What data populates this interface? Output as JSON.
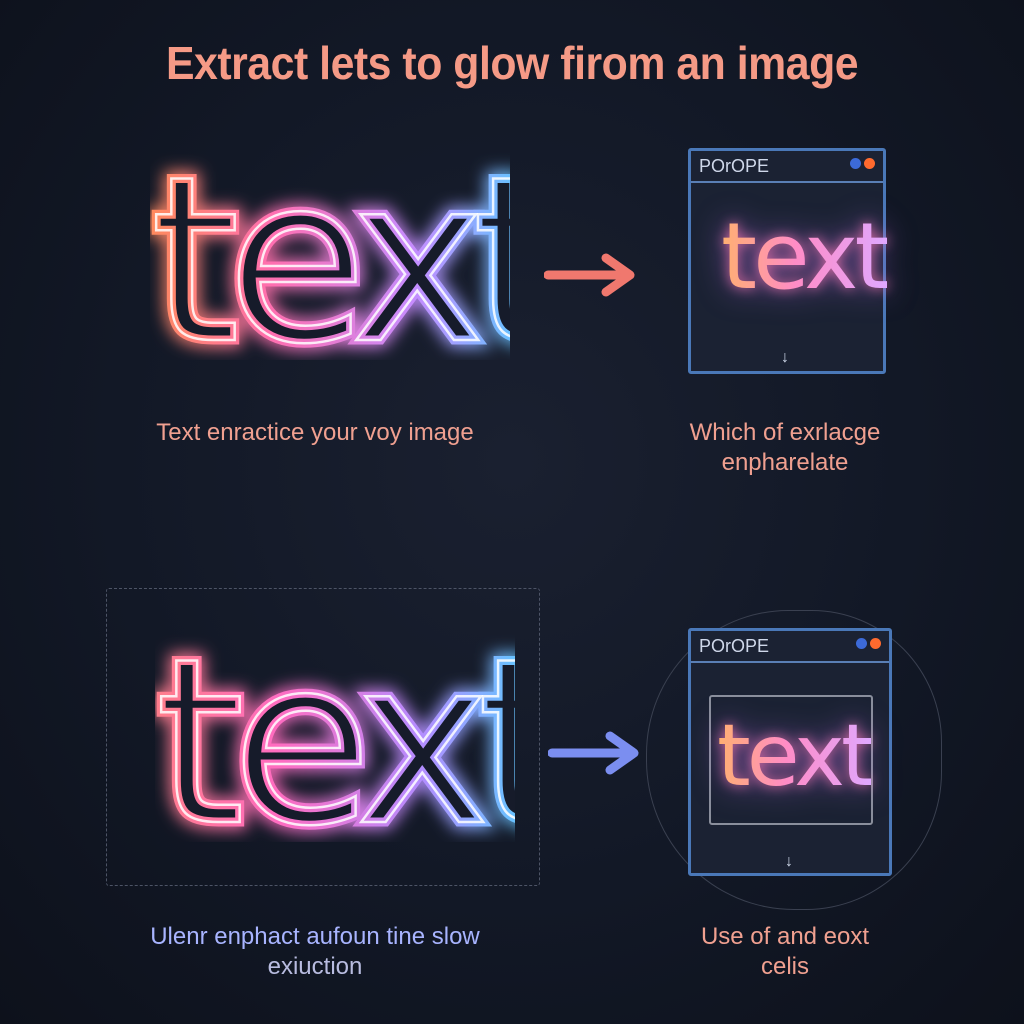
{
  "title": "Extract lets to glow firom an image",
  "glow_word": "text",
  "top": {
    "caption_left": "Text enractice your voy image",
    "caption_right": [
      "Which of exrlacge",
      "enpharelate"
    ],
    "popup_title": "POrOPE",
    "popup_word": "text",
    "popup_glyph": "↓",
    "arrow_color": "#f0786e"
  },
  "bottom": {
    "caption_left": [
      "Ulenr enphact aufoun tine slow",
      "exiuction"
    ],
    "caption_right": [
      "Use of and eoxt",
      "celis"
    ],
    "popup_title": "POrOPE",
    "popup_word": "text",
    "popup_glyph": "↓",
    "arrow_color": "#7b8ef0"
  },
  "colors": {
    "background": "#121826",
    "title": "#f59a86",
    "caption_warm": "#f0a090",
    "caption_cool": "#a8b4ff",
    "popup_border": "#4a78b8"
  }
}
